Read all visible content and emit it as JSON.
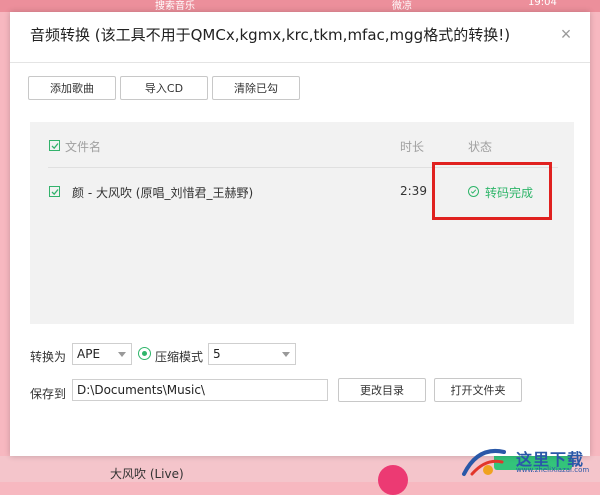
{
  "dialog": {
    "title": "音频转换 (该工具不用于QMCx,kgmx,krc,tkm,mfac,mgg格式的转换!)",
    "close_label": "×"
  },
  "toolbar": {
    "add_song_label": "添加歌曲",
    "import_cd_label": "导入CD",
    "clear_checked_label": "清除已勾"
  },
  "list": {
    "headers": {
      "filename": "文件名",
      "duration": "时长",
      "status": "状态"
    },
    "rows": [
      {
        "filename": "颜 - 大风吹 (原唱_刘惜君_王赫野)",
        "duration": "2:39",
        "status": "转码完成",
        "checked": true
      }
    ]
  },
  "options": {
    "convert_to_label": "转换为",
    "format_value": "APE",
    "compress_mode_label": "压缩模式",
    "compress_value": "5",
    "save_to_label": "保存到",
    "save_path": "D:\\Documents\\Music\\",
    "change_dir_label": "更改目录",
    "open_folder_label": "打开文件夹"
  },
  "background": {
    "search_text": "搜索音乐",
    "top_right_text": "微凉",
    "time_text": "19:04",
    "now_playing": "大风吹 (Live)"
  },
  "watermark": {
    "text": "这里下载",
    "sub": "www.zheliXiazai.com"
  },
  "colors": {
    "accent_green": "#2fb56a",
    "highlight_red": "#e0211f",
    "background_pink": "#f7b8c0"
  }
}
